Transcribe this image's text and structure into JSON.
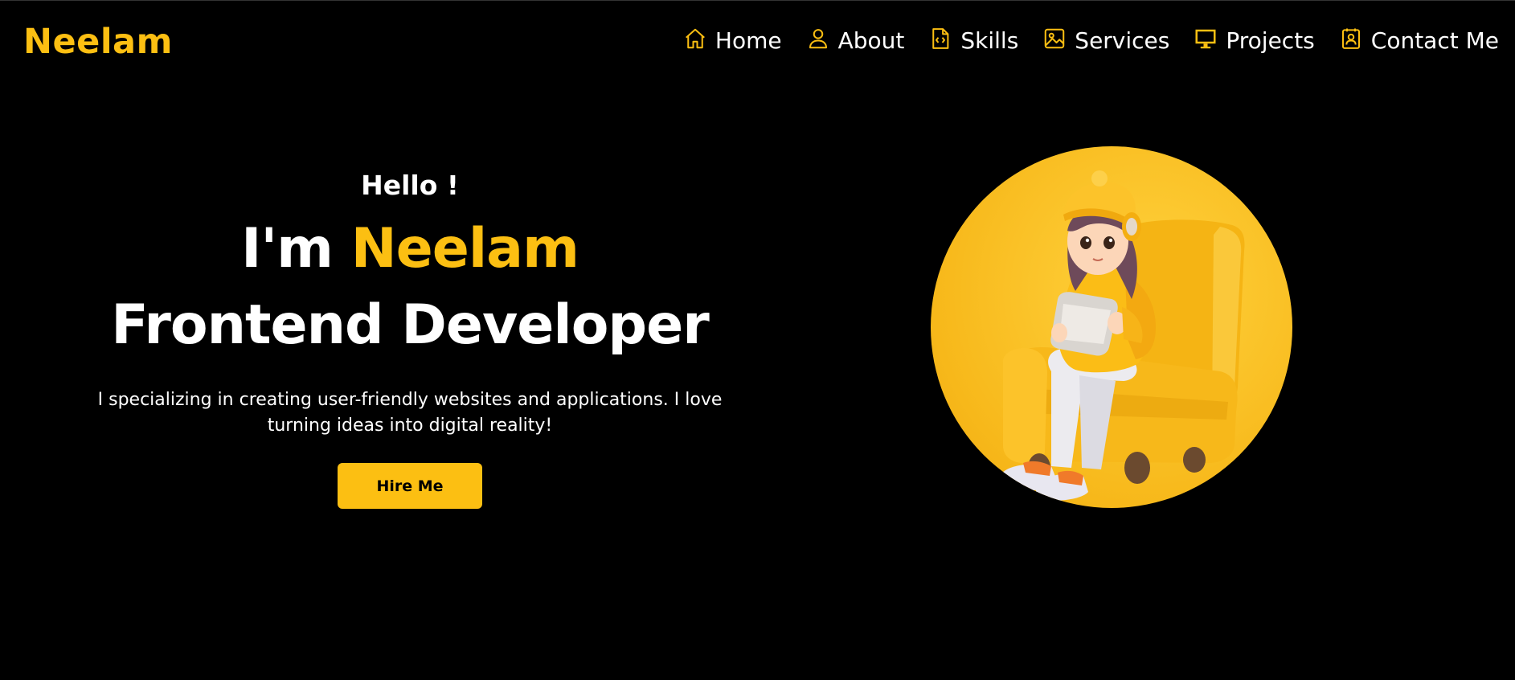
{
  "brand": {
    "logo_text": "Neelam",
    "accent_color": "#fcbf12"
  },
  "nav": {
    "items": [
      {
        "label": "Home",
        "icon": "home-icon"
      },
      {
        "label": "About",
        "icon": "user-icon"
      },
      {
        "label": "Skills",
        "icon": "code-file-icon"
      },
      {
        "label": "Services",
        "icon": "image-icon"
      },
      {
        "label": "Projects",
        "icon": "monitor-icon"
      },
      {
        "label": "Contact Me",
        "icon": "contact-card-icon"
      }
    ]
  },
  "hero": {
    "greeting": "Hello !",
    "name_prefix": "I'm ",
    "name": "Neelam",
    "role": "Frontend Developer",
    "intro": "I specializing in creating user-friendly websites and applications. I love turning ideas into digital reality!",
    "cta_label": "Hire Me",
    "illustration": "girl-on-yellow-armchair-with-tablet-illustration"
  }
}
